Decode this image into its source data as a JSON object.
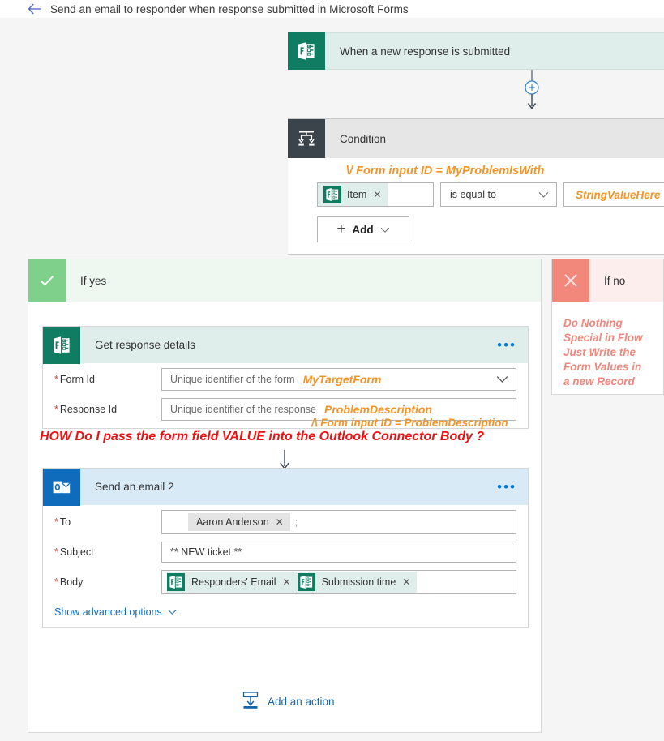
{
  "header": {
    "back_icon": "back-arrow-icon",
    "title": "Send an email to responder when response submitted in Microsoft Forms"
  },
  "trigger": {
    "icon": "microsoft-forms-icon",
    "title": "When a new response is submitted"
  },
  "connector": {
    "plus_icon": "add-step-plus-icon",
    "arrow_icon": "arrow-down-icon"
  },
  "condition": {
    "icon": "condition-icon",
    "title": "Condition",
    "annotation": "\\/ Form input ID = MyProblemIsWith",
    "row": {
      "operand_token": {
        "icon": "microsoft-forms-icon",
        "label": "Item",
        "remove_icon": "close-icon"
      },
      "operator": {
        "value": "is equal to",
        "chevron_icon": "chevron-down-icon"
      },
      "value": "StringValueHere"
    },
    "add_button": {
      "plus_icon": "plus-icon",
      "label": "Add",
      "chevron_icon": "chevron-down-icon"
    }
  },
  "branch_yes": {
    "badge_icon": "checkmark-icon",
    "label": "If yes"
  },
  "branch_no": {
    "badge_icon": "close-x-icon",
    "label": "If no",
    "note": "Do Nothing\nSpecial in Flow\nJust Write the\nForm Values in\na new Record"
  },
  "get_response": {
    "icon": "microsoft-forms-icon",
    "title": "Get response details",
    "menu_icon": "ellipsis-icon",
    "fields": [
      {
        "label": "Form Id",
        "required": true,
        "placeholder": "Unique identifier of the form",
        "annotation": "MyTargetForm",
        "has_chevron": true,
        "chevron_icon": "chevron-down-icon"
      },
      {
        "label": "Response Id",
        "required": true,
        "placeholder": "Unique identifier of the response",
        "annotation": "ProblemDescription",
        "has_chevron": false
      }
    ],
    "sub_annotation": "/\\ Form input ID =  ProblemDescription"
  },
  "question_annotation": "HOW Do I pass the form field VALUE into the Outlook Connector Body ?",
  "send_email": {
    "icon": "outlook-icon",
    "title": "Send an email 2",
    "menu_icon": "ellipsis-icon",
    "to": {
      "label": "To",
      "required": true,
      "token": {
        "label": "Aaron Anderson",
        "remove_icon": "close-icon"
      },
      "separator": ";"
    },
    "subject": {
      "label": "Subject",
      "required": true,
      "value": "** NEW ticket **"
    },
    "body": {
      "label": "Body",
      "required": true,
      "tokens": [
        {
          "icon": "microsoft-forms-icon",
          "label": "Responders' Email",
          "remove_icon": "close-icon"
        },
        {
          "icon": "microsoft-forms-icon",
          "label": "Submission time",
          "remove_icon": "close-icon"
        }
      ]
    },
    "advanced_link": {
      "label": "Show advanced options",
      "chevron_icon": "chevron-down-icon"
    }
  },
  "footer": {
    "add_action_icon": "add-action-icon",
    "add_action_label": "Add an action"
  },
  "colors": {
    "forms_green": "#107c62",
    "outlook_blue": "#0f6cbd",
    "annotation_orange": "#f59325",
    "annotation_red": "#ee1111",
    "branch_yes_green": "#7ed08b",
    "branch_no_red": "#f2877c",
    "link_blue": "#1565ad"
  }
}
